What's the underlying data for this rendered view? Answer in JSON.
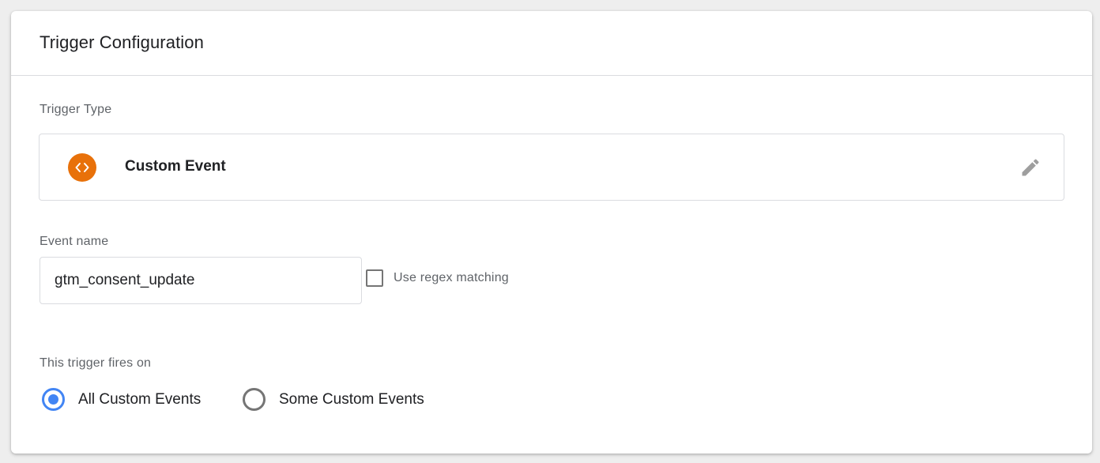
{
  "header": {
    "title": "Trigger Configuration"
  },
  "trigger_type": {
    "label": "Trigger Type",
    "name": "Custom Event",
    "icon": "code-brackets-icon",
    "icon_color": "#e8710a",
    "edit_icon": "pencil-icon"
  },
  "event_name": {
    "label": "Event name",
    "value": "gtm_consent_update",
    "regex_label": "Use regex matching",
    "regex_checked": false
  },
  "fires_on": {
    "label": "This trigger fires on",
    "options": [
      {
        "label": "All Custom Events",
        "selected": true
      },
      {
        "label": "Some Custom Events",
        "selected": false
      }
    ],
    "accent_color": "#4285f4"
  }
}
